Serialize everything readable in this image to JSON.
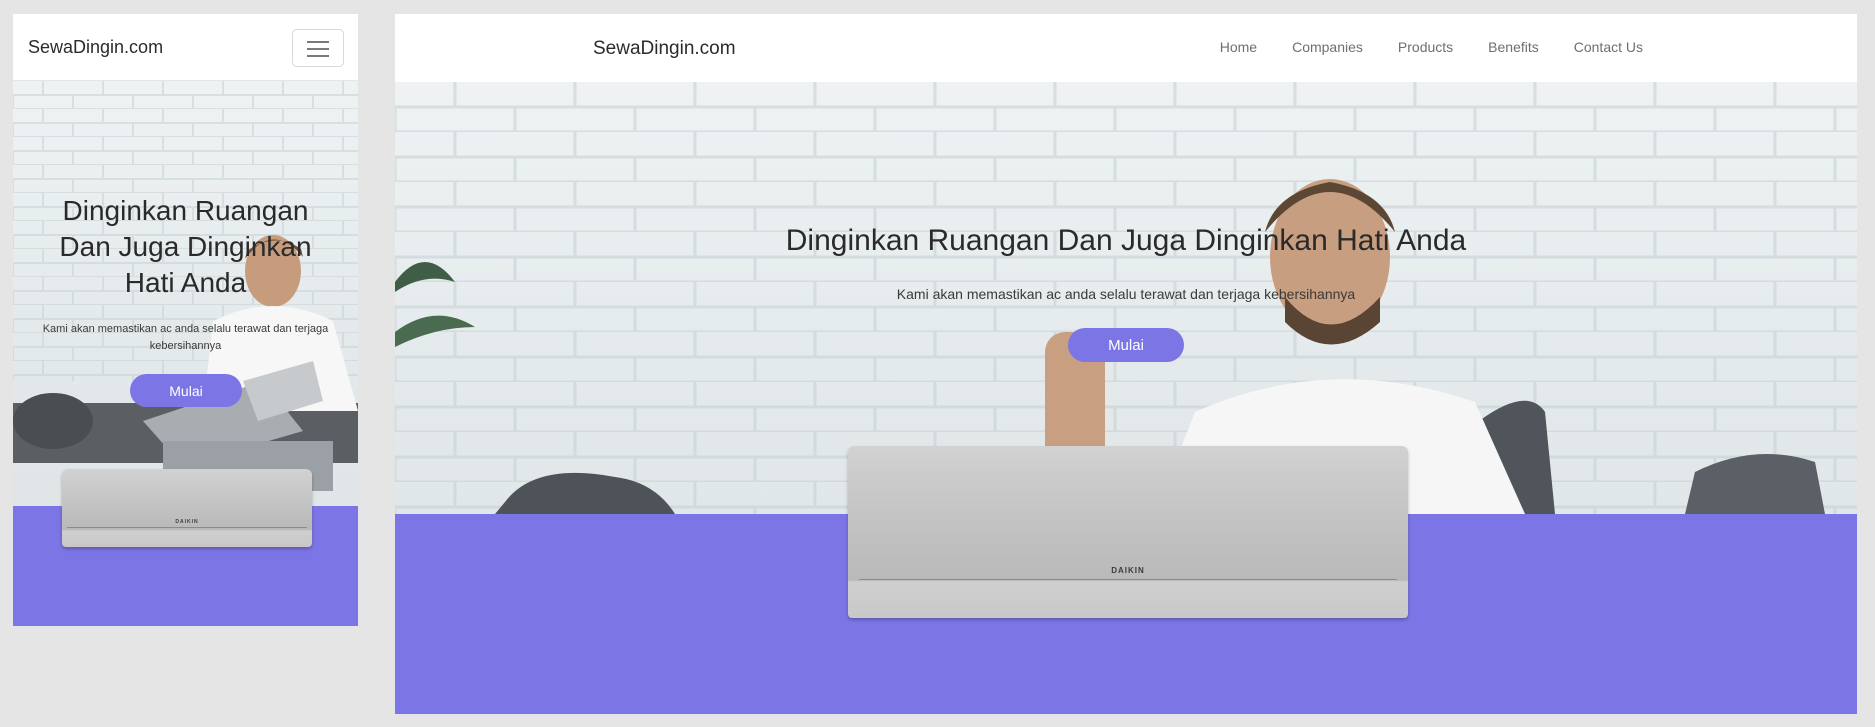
{
  "mobile": {
    "brand": "SewaDingin.com",
    "menu_icon": "hamburger-icon",
    "hero": {
      "title": "Dinginkan Ruangan Dan Juga Dinginkan Hati Anda",
      "subtitle": "Kami akan memastikan ac anda selalu terawat dan terjaga kebersihannya",
      "button": "Mulai"
    }
  },
  "desktop": {
    "brand": "SewaDingin.com",
    "nav": {
      "items": [
        {
          "label": "Home"
        },
        {
          "label": "Companies"
        },
        {
          "label": "Products"
        },
        {
          "label": "Benefits"
        },
        {
          "label": "Contact Us"
        }
      ]
    },
    "hero": {
      "title": "Dinginkan Ruangan Dan Juga Dinginkan Hati Anda",
      "subtitle": "Kami akan memastikan ac anda selalu terawat dan terjaga kebersihannya",
      "button": "Mulai"
    }
  },
  "colors": {
    "accent": "#7c75e6",
    "background": "#e5e5e5",
    "text": "#2a2a2a",
    "nav_text": "#6f6f6f"
  },
  "ac_logo": "DAIKIN"
}
